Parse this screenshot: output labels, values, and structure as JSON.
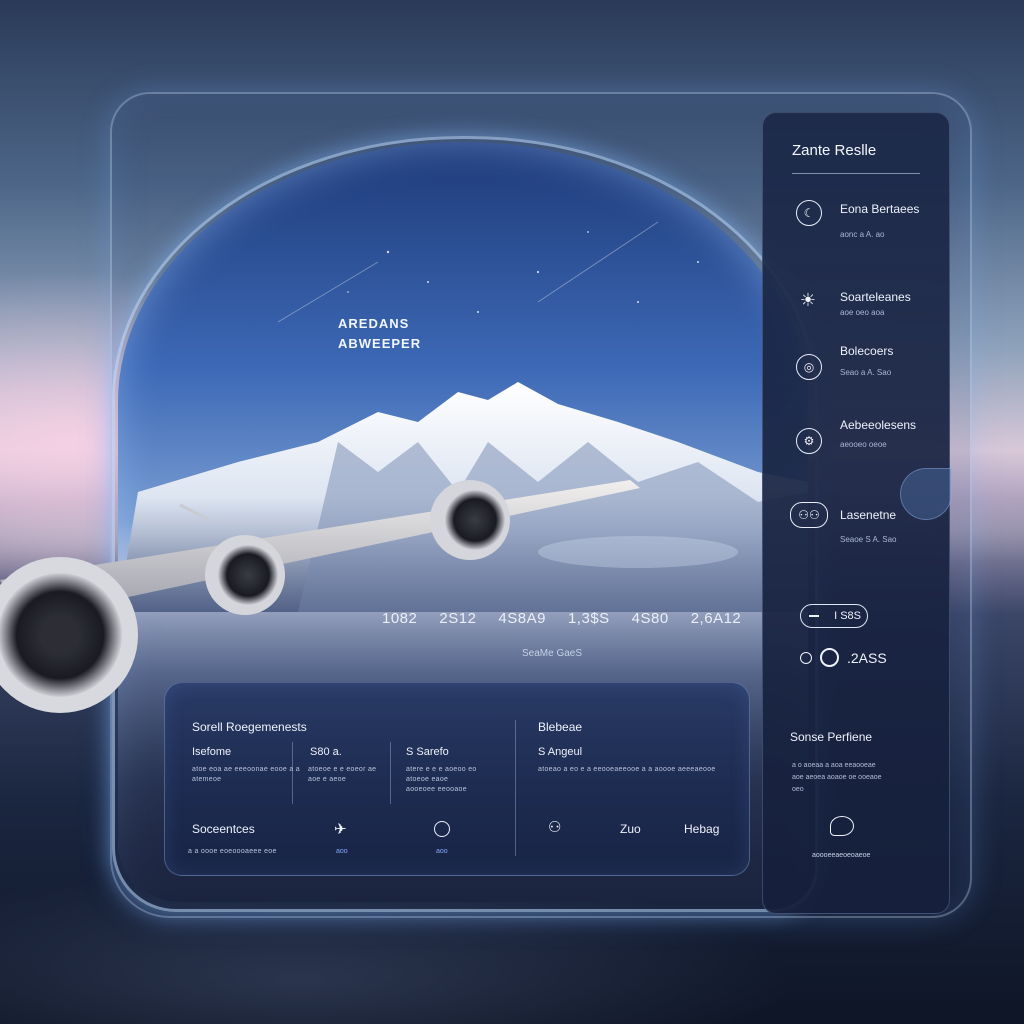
{
  "viewport": {
    "title_line1": "AREDANS",
    "title_line2": "ABWEEPER",
    "metrics": [
      "1082",
      "2S12",
      "4S8A9",
      "1,3$S",
      "4S80",
      "2,6A12"
    ],
    "metrics_caption": "SeaMe GaeS"
  },
  "bottom_panel": {
    "left_title": "Sorell Roegemenests",
    "col1_label": "Isefome",
    "col1_desc": "atoe eoa ae eeeoonae eooe a a",
    "col1_desc2": "atemeoe",
    "col2_value": "S80 a.",
    "col2_desc": "atoeoe e e eoeor ae",
    "col2_desc2": "aoe e aeoe",
    "col3_value": "S Sarefo",
    "col3_desc": "atere e e e aoeoo eo",
    "col3_desc2": "atoeoe eaoe",
    "col3_desc3": "aooeoee eeooaoe",
    "action_label": "Soceentces",
    "action_desc": "a a oooe eoeoooaeee eoe",
    "action_icon1_caption": "aoo",
    "action_icon2_caption": "aoo",
    "right_title": "Blebeae",
    "right_sub": "S Angeul",
    "right_desc": "atoeao a eo e a eeooeaeeooe a a aoooe aeeeaeooe",
    "right_icon3_label": "Hebag",
    "right_icon2_label": "Zuo"
  },
  "sidebar": {
    "title": "Zante Reslle",
    "items": [
      {
        "label": "Eona Bertaees",
        "sub": "aonc   a A. ao",
        "icon": "moon-icon"
      },
      {
        "label": "Soarteleanes",
        "sub": "aoe oeo aoa",
        "icon": "sun-icon"
      },
      {
        "label": "Bolecoers",
        "sub": "Seao   a A. Sao",
        "icon": "circle-icon"
      },
      {
        "label": "Aebeeolesens",
        "sub": "aeooeo oeoe",
        "icon": "gear-icon"
      },
      {
        "label": "Lasenetne",
        "sub": "Seaoe   S A. Sao",
        "icon": "group-icon"
      }
    ],
    "pill_value": "I S8S",
    "dots_value": ".2ASS",
    "section_title": "Sonse Perfiene",
    "section_desc1": "a o aoeaa a aoa eeaooeae",
    "section_desc2": "aoe aeoea aoaoe oe ooeaoe",
    "section_desc3": "oeo",
    "footer": "aoooeeaeoeoaeoe"
  }
}
